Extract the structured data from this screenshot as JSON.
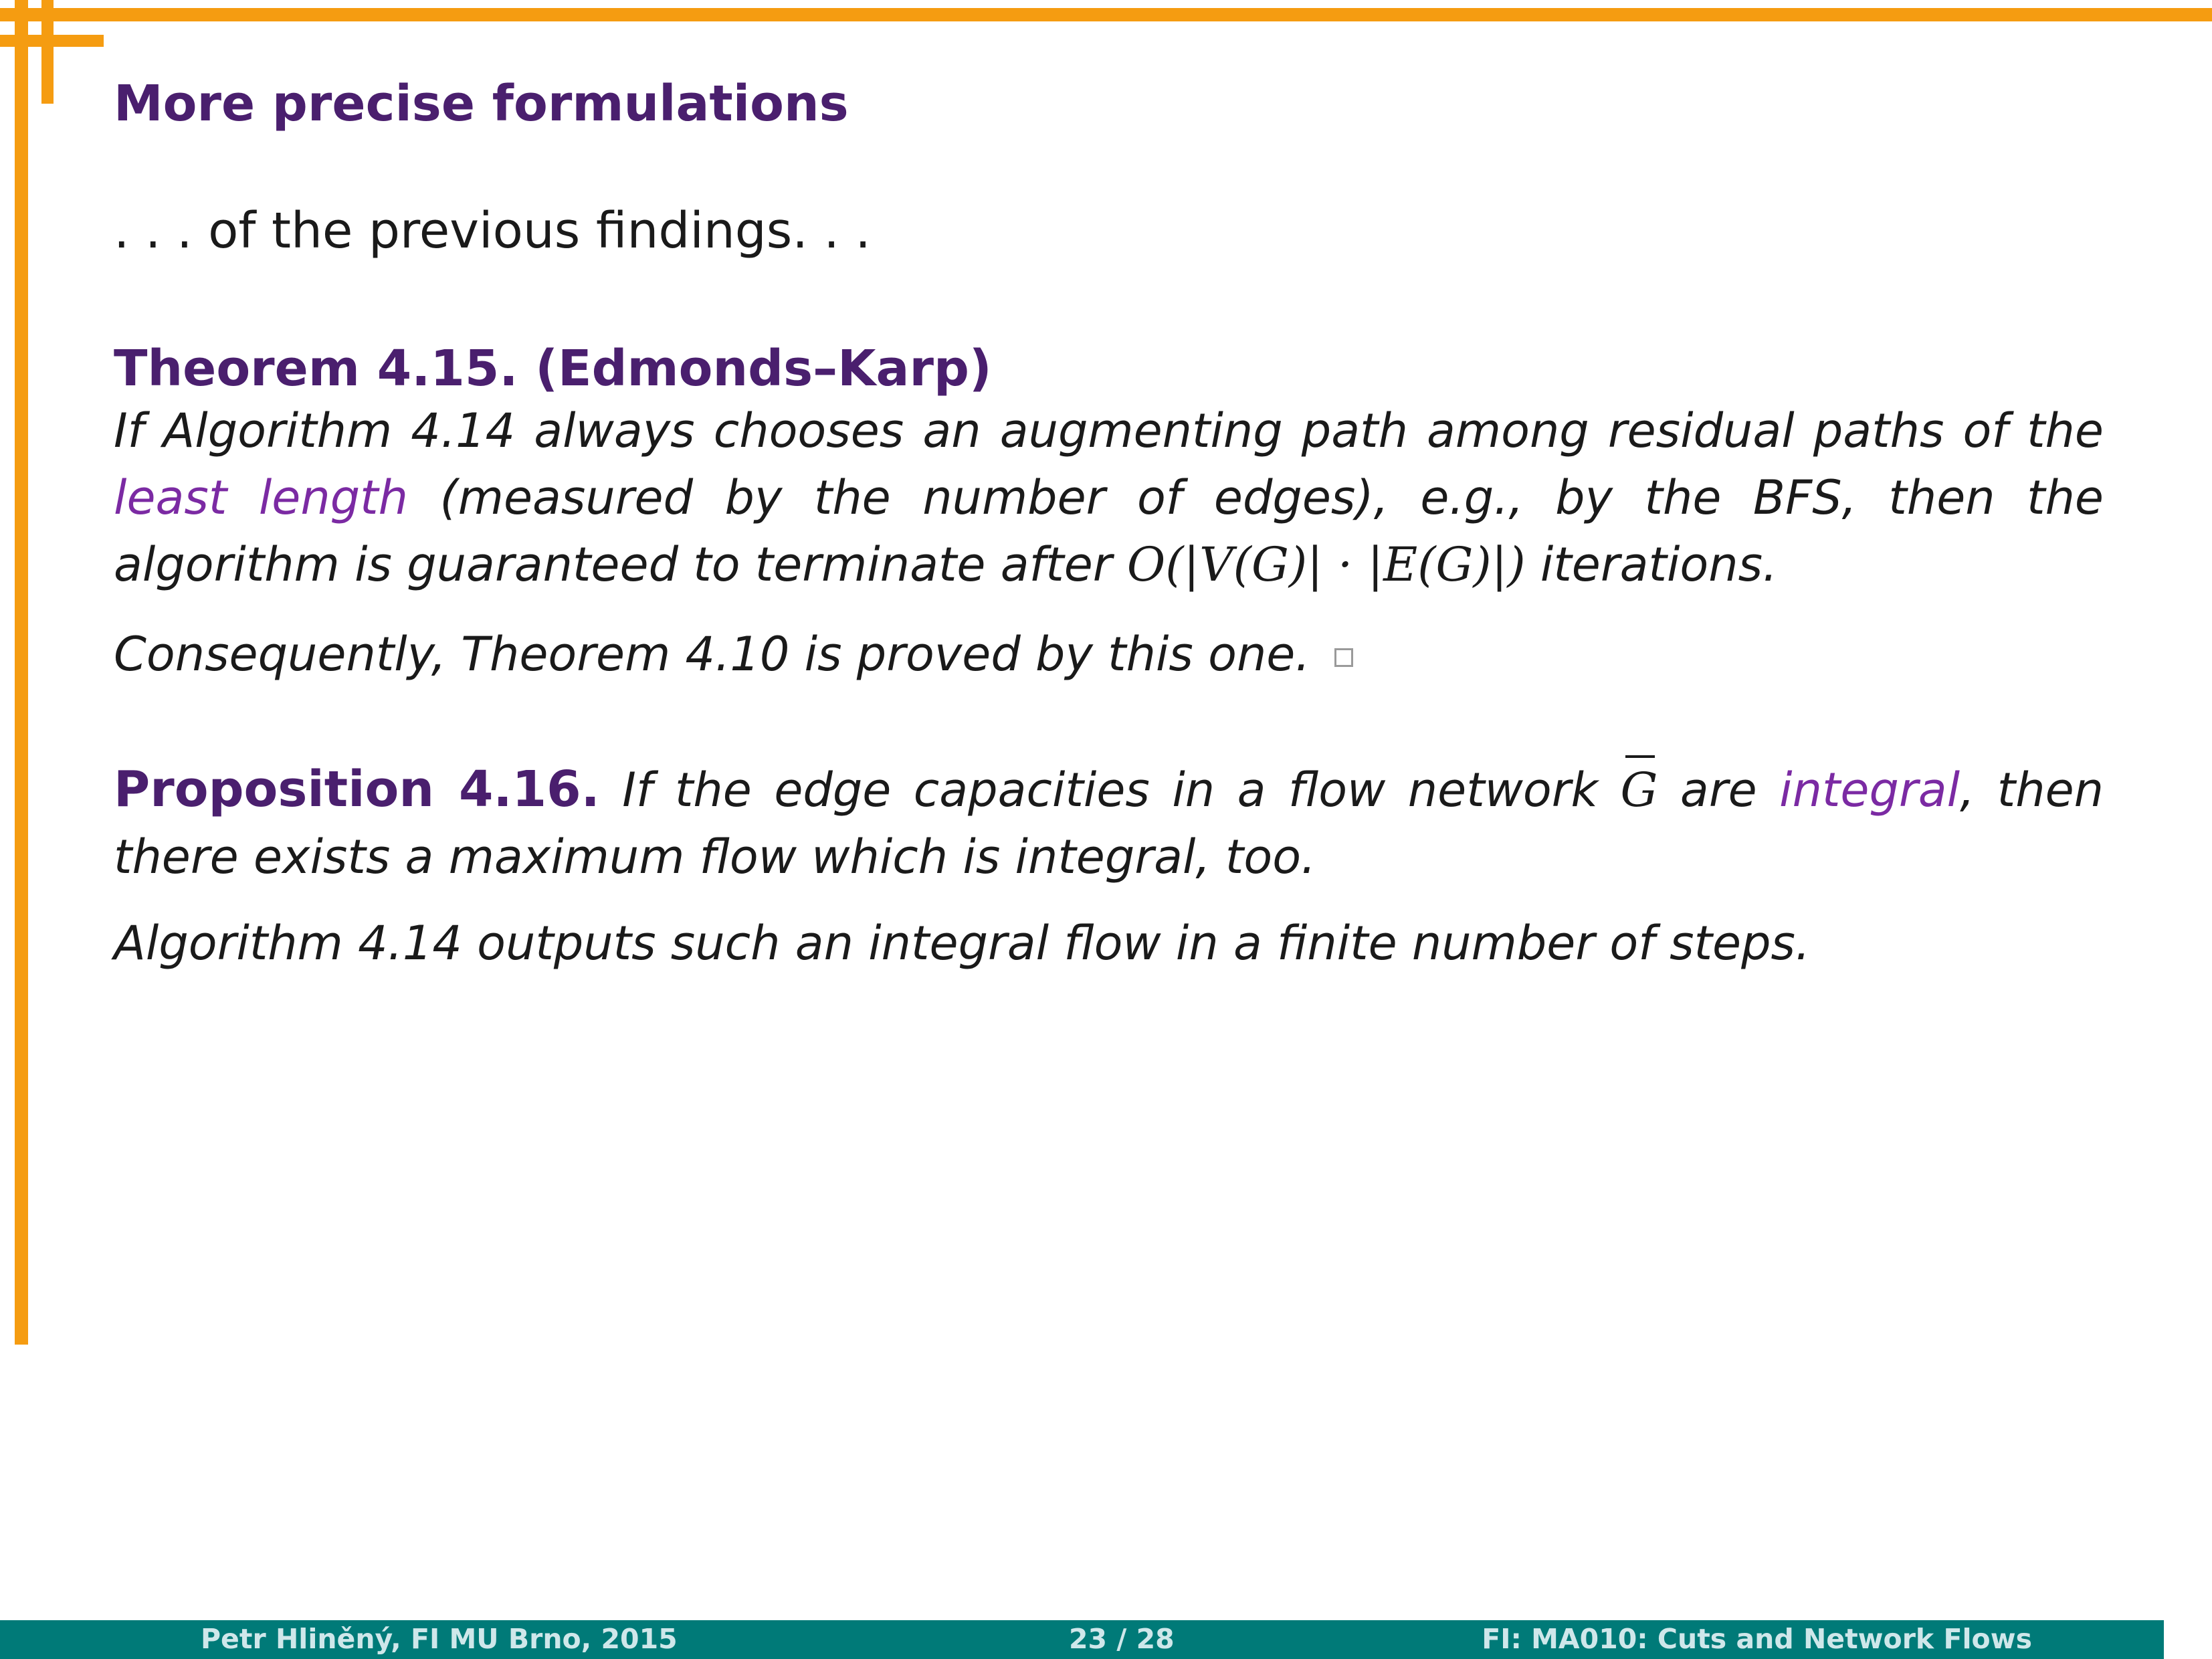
{
  "slide": {
    "title": "More precise formulations",
    "intro": ". . . of the previous findings. . ."
  },
  "theorem": {
    "head": "Theorem 4.15. (Edmonds–Karp)",
    "text_1": "If Algorithm 4.14 always chooses an augmenting path among residual paths of the ",
    "highlight": "least length",
    "text_2": " (measured by the number of edges), e.g., by the BFS, then the algorithm is guaranteed to terminate after ",
    "formula": "O(|V(G)| · |E(G)|)",
    "text_3": " iterations."
  },
  "consequence": {
    "text": "Consequently, Theorem 4.10 is proved by this one."
  },
  "proposition": {
    "head": "Proposition 4.16.",
    "text_1": " If the edge capacities in a flow network ",
    "symbol": "G",
    "text_2": " are ",
    "highlight": "integral",
    "text_3": ", then there exists a maximum flow which is integral, too."
  },
  "algorithm_note": {
    "text": "Algorithm 4.14 outputs such an integral flow in a finite number of steps."
  },
  "footer": {
    "author": "Petr Hliněný,  FI MU Brno,  2015",
    "page": "23 / 28",
    "course": "FI: MA010:  Cuts and Network Flows"
  },
  "colors": {
    "frame": "#f59c11",
    "title": "#4a1f6e",
    "accent": "#7b2aa3",
    "footer_bg": "#007a78",
    "footer_text": "#cfe7ea"
  },
  "icons": {
    "qed": "qed-square-icon"
  }
}
